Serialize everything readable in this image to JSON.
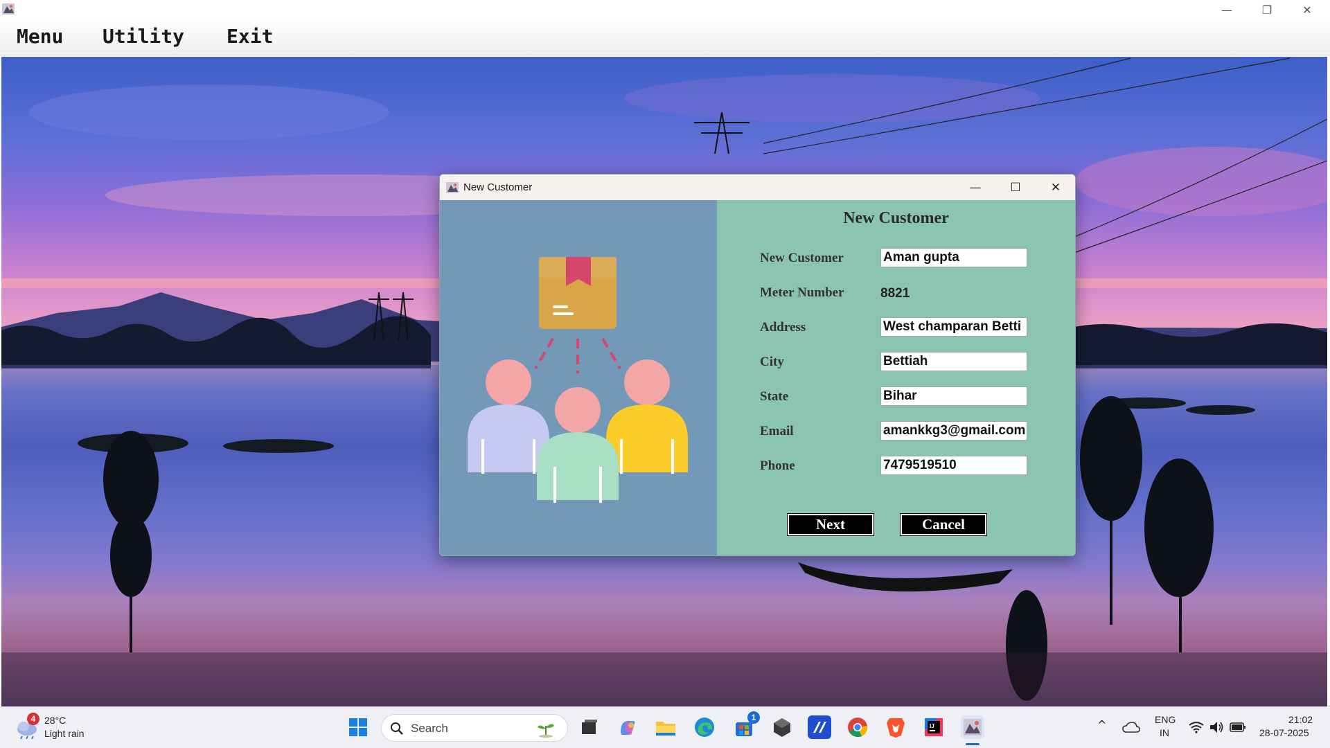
{
  "menubar": {
    "items": [
      "Menu",
      "Utility",
      "Exit"
    ]
  },
  "dialog": {
    "title": "New Customer",
    "heading": "New Customer",
    "fields": [
      {
        "label": "New Customer",
        "value": "Aman gupta",
        "editable": true
      },
      {
        "label": "Meter Number",
        "value": "8821",
        "editable": false
      },
      {
        "label": "Address",
        "value": "West champaran Betti",
        "editable": true
      },
      {
        "label": "City",
        "value": "Bettiah",
        "editable": true
      },
      {
        "label": "State",
        "value": "Bihar",
        "editable": true
      },
      {
        "label": "Email",
        "value": "amankkg3@gmail.com",
        "editable": true
      },
      {
        "label": "Phone",
        "value": "7479519510",
        "editable": true
      }
    ],
    "next_label": "Next",
    "cancel_label": "Cancel"
  },
  "taskbar": {
    "weather": {
      "temperature": "28°C",
      "condition": "Light rain",
      "badge": "4"
    },
    "search_placeholder": "Search",
    "store_badge": "1",
    "tray": {
      "language": "ENG",
      "region": "IN",
      "time": "21:02",
      "date": "28-07-2025"
    }
  },
  "colors": {
    "dialog_left_bg": "#7398b8",
    "dialog_right_bg": "#8cc4b4",
    "button_bg": "#000000"
  }
}
